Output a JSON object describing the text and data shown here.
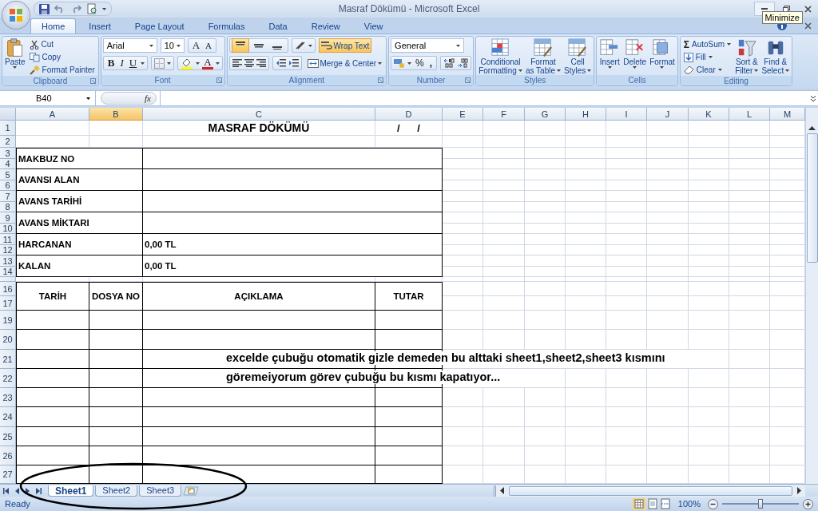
{
  "window": {
    "title": "Masraf Dökümü - Microsoft Excel",
    "tooltip": "Minimize"
  },
  "tabs": [
    {
      "label": "Home",
      "selected": true
    },
    {
      "label": "Insert",
      "selected": false
    },
    {
      "label": "Page Layout",
      "selected": false
    },
    {
      "label": "Formulas",
      "selected": false
    },
    {
      "label": "Data",
      "selected": false
    },
    {
      "label": "Review",
      "selected": false
    },
    {
      "label": "View",
      "selected": false
    }
  ],
  "clipboard": {
    "label": "Clipboard",
    "paste": "Paste",
    "items": [
      "Cut",
      "Copy",
      "Format Painter"
    ]
  },
  "font": {
    "label": "Font",
    "name": "Arial",
    "size": "10",
    "grow": "A",
    "shrink": "A",
    "bold": "B",
    "italic": "I",
    "underline": "U",
    "font_color": "A"
  },
  "alignment": {
    "label": "Alignment",
    "vertical": [
      {
        "selected": true
      },
      {
        "selected": false
      },
      {
        "selected": false
      }
    ],
    "wrap_text": {
      "label": "Wrap Text",
      "on": true
    },
    "merge": "Merge & Center"
  },
  "number": {
    "label": "Number",
    "format": "General",
    "percent": "%",
    "comma": ","
  },
  "styles": {
    "label": "Styles",
    "buttons": [
      {
        "line1": "Conditional",
        "line2": "Formatting"
      },
      {
        "line1": "Format",
        "line2": "as Table"
      },
      {
        "line1": "Cell",
        "line2": "Styles"
      }
    ]
  },
  "cells": {
    "label": "Cells",
    "buttons": [
      "Insert",
      "Delete",
      "Format"
    ]
  },
  "editing": {
    "label": "Editing",
    "sigma": "Σ",
    "items": [
      "AutoSum",
      "Fill",
      "Clear"
    ],
    "buttons": [
      {
        "line1": "Sort &",
        "line2": "Filter"
      },
      {
        "line1": "Find &",
        "line2": "Select"
      }
    ]
  },
  "formula_bar": {
    "name_box": "B40",
    "fx": "fx"
  },
  "columns": [
    {
      "label": "A",
      "selected": false
    },
    {
      "label": "B",
      "selected": true
    },
    {
      "label": "C",
      "selected": false
    },
    {
      "label": "D",
      "selected": false
    },
    {
      "label": "E",
      "selected": false
    },
    {
      "label": "F",
      "selected": false
    },
    {
      "label": "G",
      "selected": false
    },
    {
      "label": "H",
      "selected": false
    },
    {
      "label": "I",
      "selected": false
    },
    {
      "label": "J",
      "selected": false
    },
    {
      "label": "K",
      "selected": false
    },
    {
      "label": "L",
      "selected": false
    },
    {
      "label": "M",
      "selected": false
    }
  ],
  "rows": [
    "1",
    "2",
    "3",
    "4",
    "5",
    "6",
    "7",
    "8",
    "9",
    "10",
    "11",
    "12",
    "13",
    "14",
    "16",
    "17",
    "19",
    "20",
    "21",
    "22",
    "23",
    "24",
    "25",
    "26",
    "27"
  ],
  "sheet": {
    "title": "MASRAF DÖKÜMÜ",
    "date": "/      /",
    "info": [
      {
        "label": "MAKBUZ NO"
      },
      {
        "label": "AVANSI ALAN"
      },
      {
        "label": "AVANS TARİHİ"
      },
      {
        "label": "AVANS MİKTARI"
      },
      {
        "label": "HARCANAN",
        "value": "0,00 TL"
      },
      {
        "label": "KALAN",
        "value": "0,00 TL"
      }
    ],
    "table_headers": [
      "TARİH",
      "DOSYA NO",
      "AÇIKLAMA",
      "TUTAR"
    ],
    "note": [
      "excelde çubuğu otomatik gizle demeden bu alttaki sheet1,sheet2,sheet3 kısmını",
      "göremeiyorum görev çubuğu bu kısmı kapatıyor..."
    ]
  },
  "sheet_tabs": [
    {
      "label": "Sheet1",
      "selected": true
    },
    {
      "label": "Sheet2",
      "selected": false
    },
    {
      "label": "Sheet3",
      "selected": false
    }
  ],
  "status": {
    "text": "Ready",
    "zoom": "100%",
    "level": 0.5
  }
}
